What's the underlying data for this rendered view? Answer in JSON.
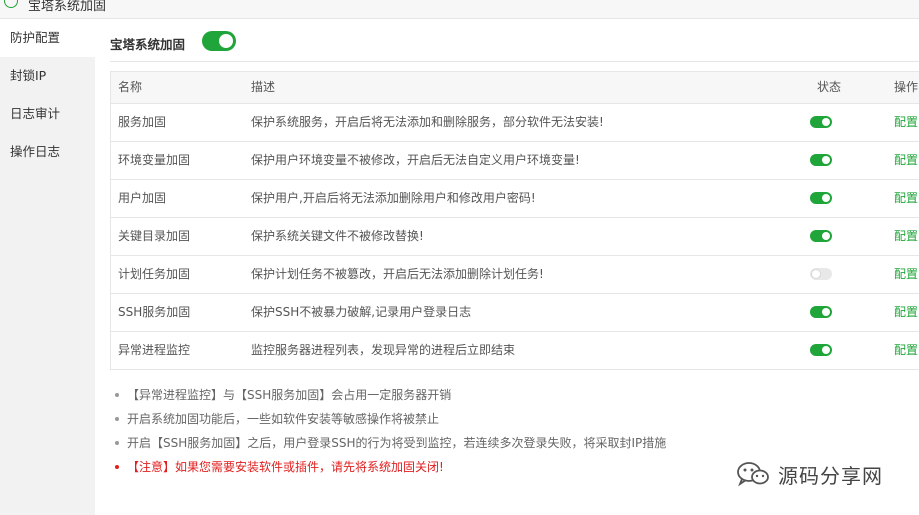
{
  "window": {
    "title": "宝塔系统加固"
  },
  "sidebar": {
    "items": [
      {
        "label": "防护配置",
        "active": true
      },
      {
        "label": "封锁IP",
        "active": false
      },
      {
        "label": "日志审计",
        "active": false
      },
      {
        "label": "操作日志",
        "active": false
      }
    ]
  },
  "header": {
    "label": "宝塔系统加固",
    "enabled": true
  },
  "table": {
    "columns": {
      "name": "名称",
      "desc": "描述",
      "status": "状态",
      "op": "操作"
    },
    "rows": [
      {
        "name": "服务加固",
        "desc": "保护系统服务，开启后将无法添加和删除服务，部分软件无法安装!",
        "enabled": true,
        "op": "配置"
      },
      {
        "name": "环境变量加固",
        "desc": "保护用户环境变量不被修改，开启后无法自定义用户环境变量!",
        "enabled": true,
        "op": "配置"
      },
      {
        "name": "用户加固",
        "desc": "保护用户,开启后将无法添加删除用户和修改用户密码!",
        "enabled": true,
        "op": "配置"
      },
      {
        "name": "关键目录加固",
        "desc": "保护系统关键文件不被修改替换!",
        "enabled": true,
        "op": "配置"
      },
      {
        "name": "计划任务加固",
        "desc": "保护计划任务不被篡改，开启后无法添加删除计划任务!",
        "enabled": false,
        "op": "配置"
      },
      {
        "name": "SSH服务加固",
        "desc": "保护SSH不被暴力破解,记录用户登录日志",
        "enabled": true,
        "op": "配置"
      },
      {
        "name": "异常进程监控",
        "desc": "监控服务器进程列表，发现异常的进程后立即结束",
        "enabled": true,
        "op": "配置"
      }
    ]
  },
  "notes": [
    "【异常进程监控】与【SSH服务加固】会占用一定服务器开销",
    "开启系统加固功能后，一些如软件安装等敏感操作将被禁止",
    "开启【SSH服务加固】之后，用户登录SSH的行为将受到监控，若连续多次登录失败，将采取封IP措施",
    "【注意】如果您需要安装软件或插件，请先将系统加固关闭!"
  ],
  "watermark": {
    "text": "源码分享网",
    "icon": "wechat-icon"
  },
  "colors": {
    "accent": "#20a53a",
    "warning": "#e02020"
  }
}
